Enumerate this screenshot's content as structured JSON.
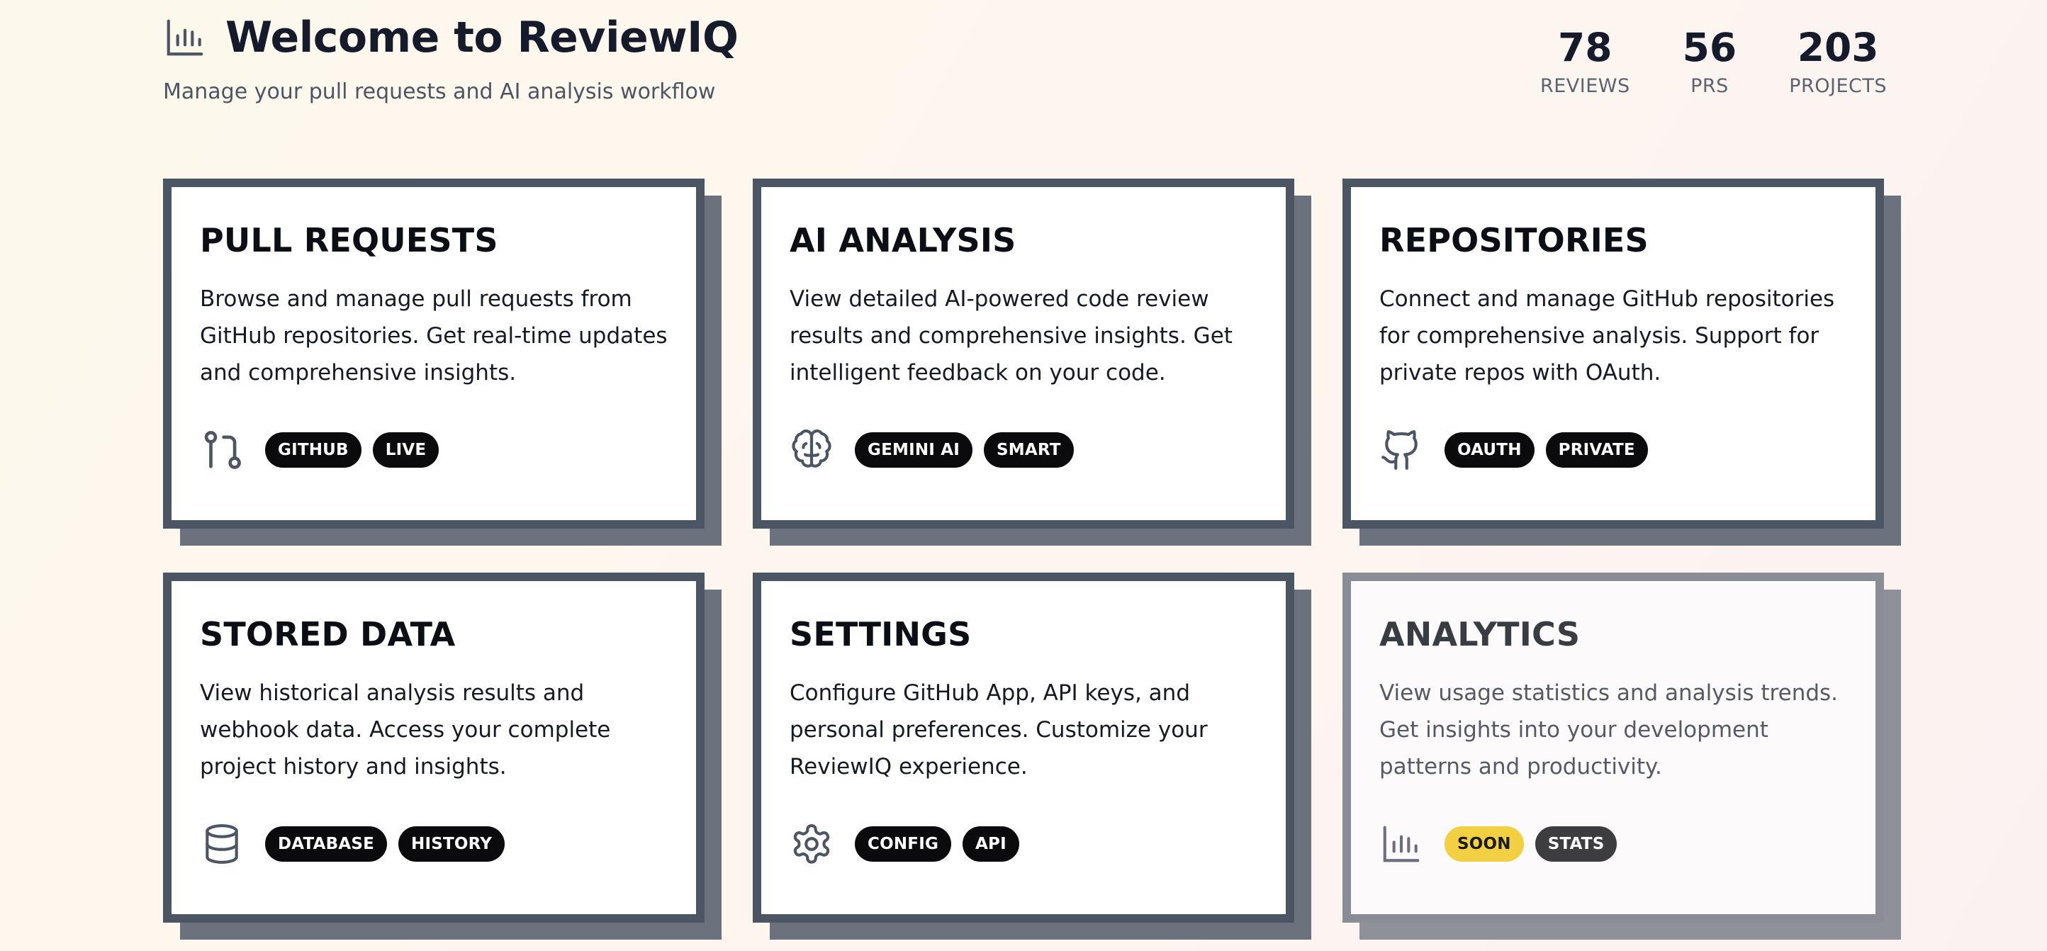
{
  "header": {
    "title": "Welcome to ReviewIQ",
    "subtitle": "Manage your pull requests and AI analysis workflow",
    "icon": "bar-chart-icon"
  },
  "stats": [
    {
      "value": "78",
      "label": "REVIEWS"
    },
    {
      "value": "56",
      "label": "PRS"
    },
    {
      "value": "203",
      "label": "PROJECTS"
    }
  ],
  "cards": [
    {
      "title": "PULL REQUESTS",
      "description": "Browse and manage pull requests from GitHub repositories. Get real-time updates and comprehensive insights.",
      "icon": "git-pull-request-icon",
      "badges": [
        "GITHUB",
        "LIVE"
      ]
    },
    {
      "title": "AI ANALYSIS",
      "description": "View detailed AI-powered code review results and comprehensive insights. Get intelligent feedback on your code.",
      "icon": "brain-icon",
      "badges": [
        "GEMINI AI",
        "SMART"
      ]
    },
    {
      "title": "REPOSITORIES",
      "description": "Connect and manage GitHub repositories for comprehensive analysis. Support for private repos with OAuth.",
      "icon": "github-icon",
      "badges": [
        "OAUTH",
        "PRIVATE"
      ]
    },
    {
      "title": "STORED DATA",
      "description": "View historical analysis results and webhook data. Access your complete project history and insights.",
      "icon": "database-icon",
      "badges": [
        "DATABASE",
        "HISTORY"
      ]
    },
    {
      "title": "SETTINGS",
      "description": "Configure GitHub App, API keys, and personal preferences. Customize your ReviewIQ experience.",
      "icon": "gear-icon",
      "badges": [
        "CONFIG",
        "API"
      ]
    },
    {
      "title": "ANALYTICS",
      "description": "View usage statistics and analysis trends. Get insights into your development patterns and productivity.",
      "icon": "bar-chart-icon",
      "badges": [
        "SOON",
        "STATS"
      ]
    }
  ],
  "colors": {
    "card_border": "#4b5563",
    "card_shadow": "#6b727d",
    "badge_bg": "#0b0b0d",
    "soon_badge": "#f3cf42",
    "muted_border": "#8a8d95"
  }
}
